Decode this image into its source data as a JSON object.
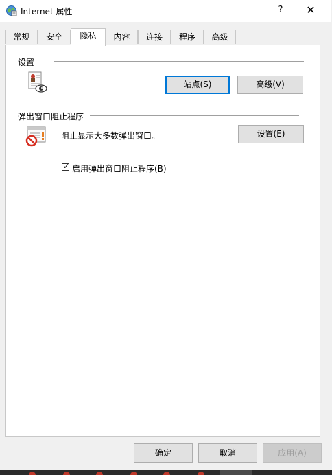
{
  "window": {
    "title": "Internet 属性",
    "help_label": "?",
    "close_label": "✕"
  },
  "tabs": [
    {
      "label": "常规"
    },
    {
      "label": "安全"
    },
    {
      "label": "隐私"
    },
    {
      "label": "内容"
    },
    {
      "label": "连接"
    },
    {
      "label": "程序"
    },
    {
      "label": "高级"
    }
  ],
  "active_tab": "隐私",
  "settings_group": {
    "title": "设置",
    "sites_button": "站点(S)",
    "advanced_button": "高级(V)"
  },
  "popup_group": {
    "title": "弹出窗口阻止程序",
    "description": "阻止显示大多数弹出窗口。",
    "settings_button": "设置(E)",
    "checkbox_label": "启用弹出窗口阻止程序(B)",
    "checkbox_checked": true
  },
  "footer": {
    "ok_button": "确定",
    "cancel_button": "取消",
    "apply_button": "应用(A)"
  },
  "colors": {
    "focus_border": "#0078d7",
    "panel_bg": "#ffffff",
    "dialog_bg": "#f0f0f0"
  }
}
